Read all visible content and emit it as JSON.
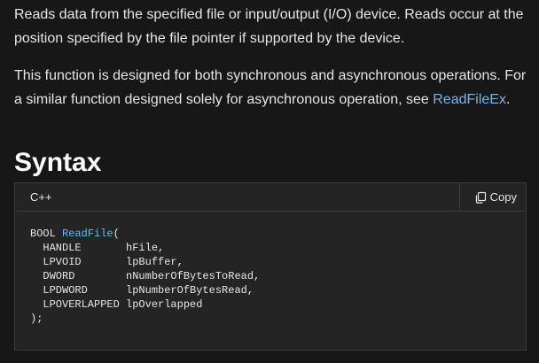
{
  "description": {
    "paragraph1": "Reads data from the specified file or input/output (I/O) device. Reads occur at the position specified by the file pointer if supported by the device.",
    "paragraph2_prefix": "This function is designed for both synchronous and asynchronous operations. For a similar function designed solely for asynchronous operation, see ",
    "paragraph2_link": "ReadFileEx",
    "paragraph2_suffix": "."
  },
  "syntax": {
    "heading": "Syntax",
    "language": "C++",
    "copy_label": "Copy",
    "copy_icon": "copy-icon",
    "code": {
      "line1_prefix": "BOOL ",
      "function_name": "ReadFile",
      "line1_suffix": "(",
      "params": [
        "  HANDLE       hFile,",
        "  LPVOID       lpBuffer,",
        "  DWORD        nNumberOfBytesToRead,",
        "  LPDWORD      lpNumberOfBytesRead,",
        "  LPOVERLAPPED lpOverlapped"
      ],
      "closing": ");"
    }
  },
  "colors": {
    "background": "#171717",
    "code_background": "#242424",
    "link": "#75b6e7",
    "function_highlight": "#4fc1ff"
  }
}
